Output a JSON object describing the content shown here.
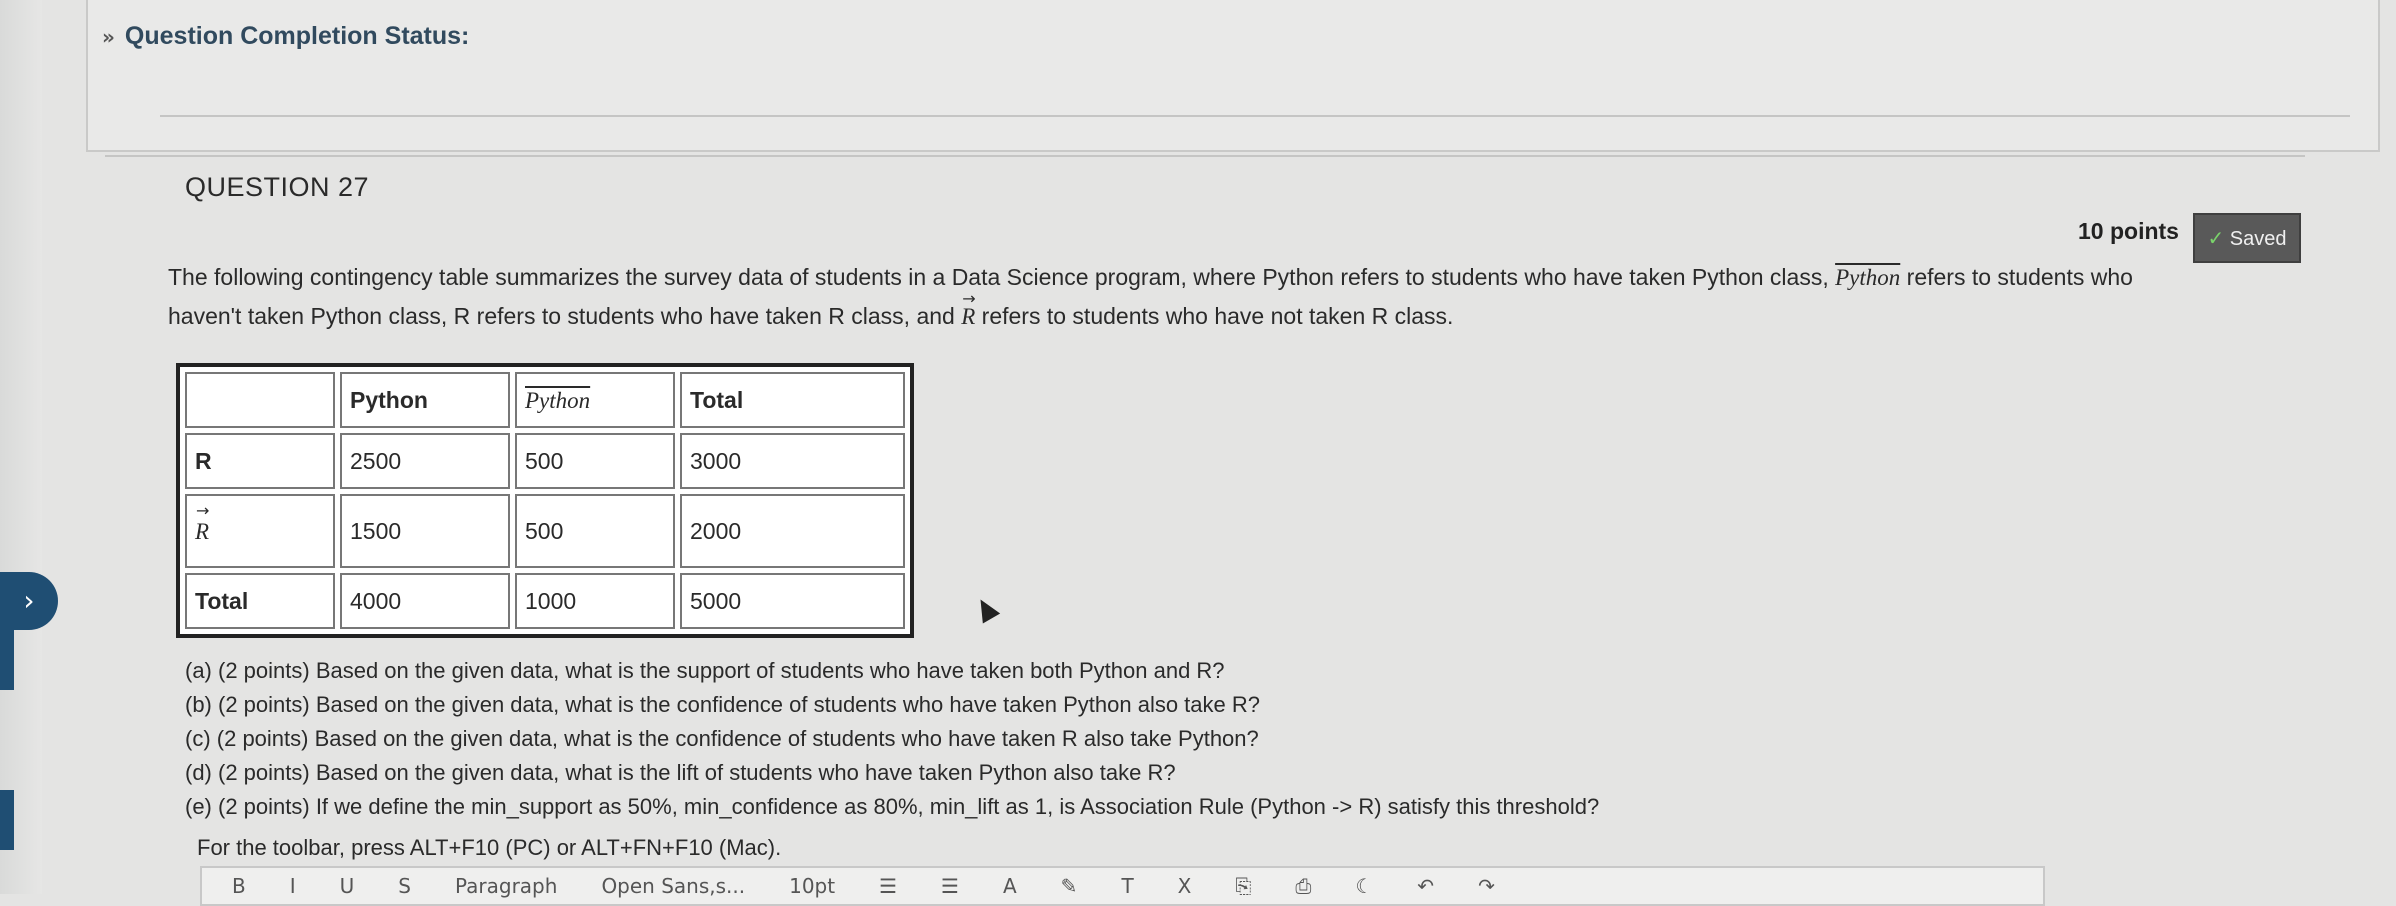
{
  "completion": {
    "title": "Question Completion Status:"
  },
  "question": {
    "title": "QUESTION 27",
    "points": "10 points",
    "saved": "Saved",
    "intro_line1_a": "The following contingency table summarizes the survey data of students in a Data Science program, where Python refers to students who have taken Python class,",
    "intro_python_bar": "Python",
    "intro_line1_b": "refers to students who",
    "intro_line2_a": "haven't taken Python class, R refers to students who have taken R class, and",
    "intro_r_vec": "R",
    "intro_line2_b": "refers to students who have not taken R class."
  },
  "table": {
    "header": [
      "",
      "Python",
      "Python",
      "Total"
    ],
    "rows": [
      [
        "R",
        "2500",
        "500",
        "3000"
      ],
      [
        "R",
        "1500",
        "500",
        "2000"
      ],
      [
        "Total",
        "4000",
        "1000",
        "5000"
      ]
    ]
  },
  "subquestions": [
    "(a) (2 points) Based on the given data, what is the support of students who have taken both Python and R?",
    "(b) (2 points) Based on the given data, what is the confidence of students who have taken Python also take R?",
    "(c) (2 points) Based on the given data, what is the confidence of students who have taken R also take Python?",
    "(d) (2 points) Based on the given data, what is the lift of students who have taken Python also take R?",
    "(e) (2 points) If we define the min_support as 50%, min_confidence as 80%, min_lift as 1, is Association Rule (Python -> R) satisfy this threshold?"
  ],
  "toolbar_note": "For the toolbar, press ALT+F10 (PC) or ALT+FN+F10 (Mac).",
  "toolbar": [
    "B",
    "I",
    "U",
    "S",
    "Paragraph",
    "Open Sans,s...",
    "10pt",
    "☰",
    "☰",
    "A",
    "✎",
    "T",
    "X",
    "⎘",
    "⎙",
    "☾",
    "↶",
    "↷"
  ]
}
